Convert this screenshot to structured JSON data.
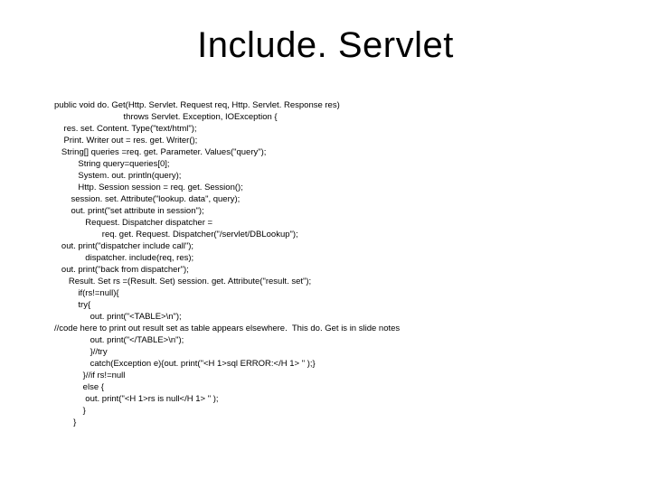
{
  "title": "Include. Servlet",
  "code_lines": [
    "public void do. Get(Http. Servlet. Request req, Http. Servlet. Response res)",
    "                             throws Servlet. Exception, IOException {",
    "    res. set. Content. Type(\"text/html\");",
    "    Print. Writer out = res. get. Writer();",
    "   String[] queries =req. get. Parameter. Values(\"query\");",
    "          String query=queries[0];",
    "          System. out. println(query);",
    "          Http. Session session = req. get. Session();",
    "       session. set. Attribute(\"lookup. data\", query);",
    "       out. print(\"set attribute in session\");",
    "             Request. Dispatcher dispatcher =",
    "                    req. get. Request. Dispatcher(\"/servlet/DBLookup\");",
    "   out. print(\"dispatcher include call\");",
    "             dispatcher. include(req, res);",
    "   out. print(\"back from dispatcher\");",
    "      Result. Set rs =(Result. Set) session. get. Attribute(\"result. set\");",
    "          if(rs!=null){",
    "          try{",
    "               out. print(\"<TABLE>\\n\");",
    "//code here to print out result set as table appears elsewhere.  This do. Get is in slide notes",
    "               out. print(\"</TABLE>\\n\");",
    "               }//try",
    "               catch(Exception e){out. print(\"<H 1>sql ERROR:</H 1> \" );}",
    "            }//if rs!=null",
    "            else {",
    "             out. print(\"<H 1>rs is null</H 1> \" );",
    "            }",
    "        }"
  ]
}
